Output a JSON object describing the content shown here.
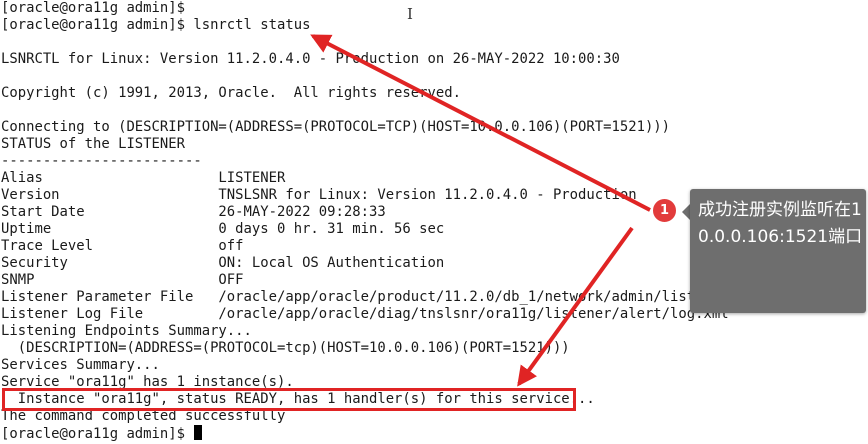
{
  "terminal": {
    "lines": [
      "[oracle@ora11g admin]$",
      "[oracle@ora11g admin]$ lsnrctl status",
      "",
      "LSNRCTL for Linux: Version 11.2.0.4.0 - Production on 26-MAY-2022 10:00:30",
      "",
      "Copyright (c) 1991, 2013, Oracle.  All rights reserved.",
      "",
      "Connecting to (DESCRIPTION=(ADDRESS=(PROTOCOL=TCP)(HOST=10.0.0.106)(PORT=1521)))",
      "STATUS of the LISTENER",
      "------------------------",
      "Alias                     LISTENER",
      "Version                   TNSLSNR for Linux: Version 11.2.0.4.0 - Production",
      "Start Date                26-MAY-2022 09:28:33",
      "Uptime                    0 days 0 hr. 31 min. 56 sec",
      "Trace Level               off",
      "Security                  ON: Local OS Authentication",
      "SNMP                      OFF",
      "Listener Parameter File   /oracle/app/oracle/product/11.2.0/db_1/network/admin/listener.ora",
      "Listener Log File         /oracle/app/oracle/diag/tnslsnr/ora11g/listener/alert/log.xml",
      "Listening Endpoints Summary...",
      "  (DESCRIPTION=(ADDRESS=(PROTOCOL=tcp)(HOST=10.0.0.106)(PORT=1521)))",
      "Services Summary...",
      "Service \"ora11g\" has 1 instance(s).",
      "  Instance \"ora11g\", status READY, has 1 handler(s) for this service...",
      "The command completed successfully",
      "[oracle@ora11g admin]$"
    ]
  },
  "annotation": {
    "badge_number": "1",
    "callout_text": "成功注册实例监听在10.0.0.106:1521端口",
    "accent_color": "#e02424",
    "callout_color": "#6e6e6e"
  },
  "icons": {
    "text_cursor": "I-beam",
    "terminal_cursor": "block"
  }
}
